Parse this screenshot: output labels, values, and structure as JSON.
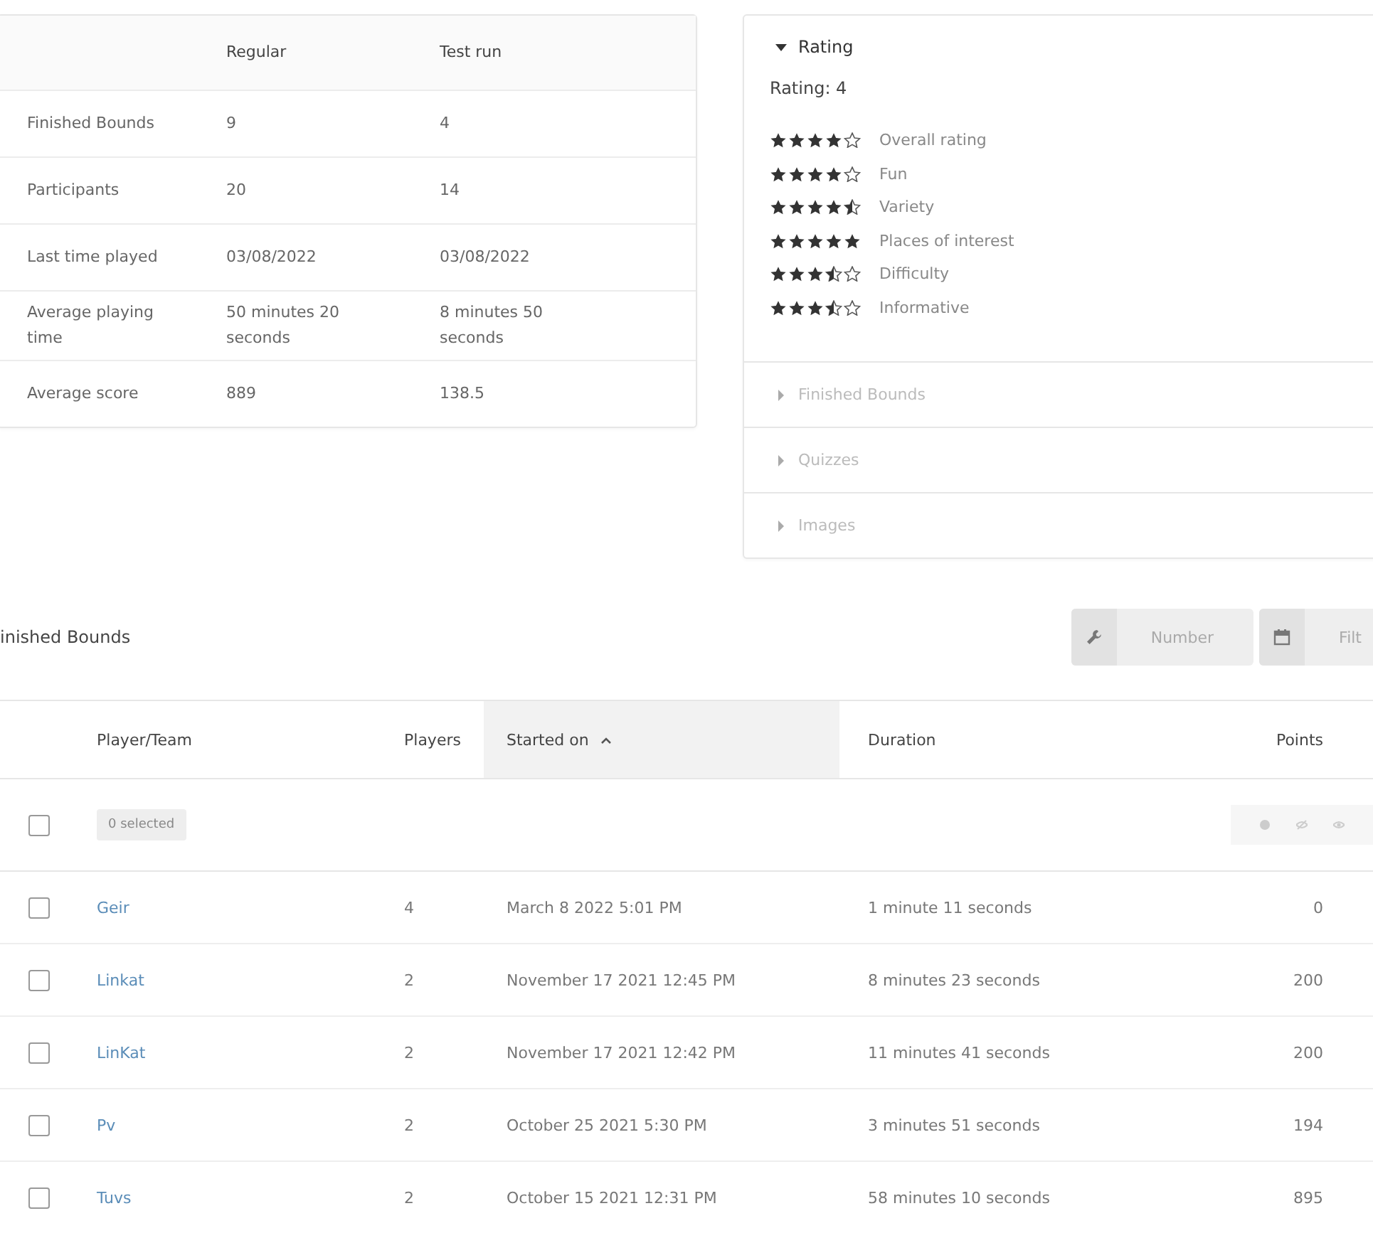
{
  "stats": {
    "columns": [
      "Regular",
      "Test run"
    ],
    "rows": [
      {
        "label": "Finished Bounds",
        "values": [
          "9",
          "4"
        ]
      },
      {
        "label": "Participants",
        "values": [
          "20",
          "14"
        ]
      },
      {
        "label": "Last time played",
        "values": [
          "03/08/2022",
          "03/08/2022"
        ]
      },
      {
        "label": "Average playing time",
        "values": [
          "50 minutes 20 seconds",
          "8 minutes 50 seconds"
        ]
      },
      {
        "label": "Average score",
        "values": [
          "889",
          "138.5"
        ]
      }
    ]
  },
  "accordion": [
    {
      "title": "Rating",
      "expanded": true,
      "summary": "Rating: 4",
      "ratings": [
        {
          "stars": 4,
          "label": "Overall rating"
        },
        {
          "stars": 4,
          "label": "Fun"
        },
        {
          "stars": 4.5,
          "label": "Variety"
        },
        {
          "stars": 5,
          "label": "Places of interest"
        },
        {
          "stars": 3.5,
          "label": "Difficulty"
        },
        {
          "stars": 3.5,
          "label": "Informative"
        }
      ]
    },
    {
      "title": "Finished Bounds",
      "expanded": false
    },
    {
      "title": "Quizzes",
      "expanded": false
    },
    {
      "title": "Images",
      "expanded": false
    }
  ],
  "finished": {
    "heading": "inished Bounds",
    "buttons": [
      {
        "kind": "wrench",
        "label": "Number"
      },
      {
        "kind": "calendar",
        "label": "Filt"
      }
    ],
    "columns": [
      {
        "label": "Player/Team",
        "sorted": false
      },
      {
        "label": "Players",
        "sorted": false
      },
      {
        "label": "Started on",
        "sorted": true
      },
      {
        "label": "Duration",
        "sorted": false
      },
      {
        "label": "Points",
        "sorted": false
      }
    ],
    "selected_count": "0 selected",
    "select_all_checked": false,
    "rows": [
      {
        "checked": false,
        "cells": [
          "Geir",
          "4",
          "March 8 2022 5:01 PM",
          "1 minute 11 seconds",
          "0"
        ]
      },
      {
        "checked": false,
        "cells": [
          "Linkat",
          "2",
          "November 17 2021 12:45 PM",
          "8 minutes 23 seconds",
          "200"
        ]
      },
      {
        "checked": false,
        "cells": [
          "LinKat",
          "2",
          "November 17 2021 12:42 PM",
          "11 minutes 41 seconds",
          "200"
        ]
      },
      {
        "checked": false,
        "cells": [
          "Pv",
          "2",
          "October 25 2021 5:30 PM",
          "3 minutes 51 seconds",
          "194"
        ]
      },
      {
        "checked": false,
        "cells": [
          "Tuvs",
          "2",
          "October 15 2021 12:31 PM",
          "58 minutes 10 seconds",
          "895"
        ]
      }
    ]
  }
}
